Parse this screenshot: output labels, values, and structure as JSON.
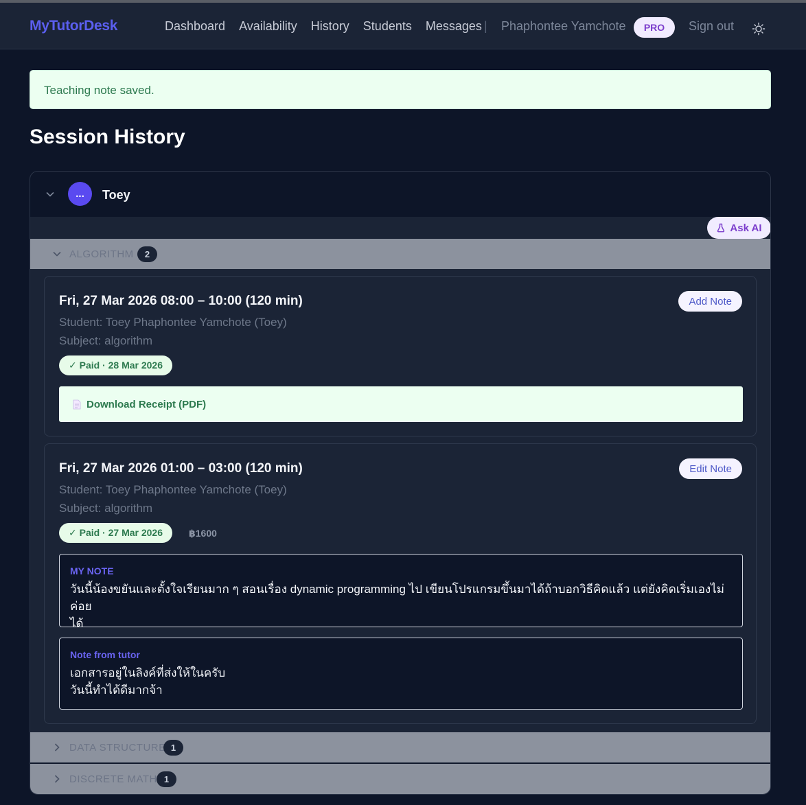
{
  "nav": {
    "brand": "MyTutorDesk",
    "links": [
      "Dashboard",
      "Availability",
      "History",
      "Students",
      "Messages"
    ],
    "separator": "|",
    "user": "Phaphontee Yamchote",
    "badge": "PRO",
    "signout": "Sign out",
    "theme_icon": "sun-icon"
  },
  "alert": {
    "message": "Teaching note saved."
  },
  "page": {
    "title": "Session History"
  },
  "student": {
    "avatar": "...",
    "name": "Toey",
    "ask_ai": "Ask AI"
  },
  "groups": [
    {
      "label": "ALGORITHM",
      "count": "2",
      "expanded": true
    },
    {
      "label": "DATA STRUCTURE",
      "count": "1",
      "expanded": false
    },
    {
      "label": "DISCRETE MATH",
      "count": "1",
      "expanded": false
    }
  ],
  "sessions": [
    {
      "date": "Fri, 27 Mar 2026 08:00 – 10:00 (120 min)",
      "student": "Student: Toey Phaphontee Yamchote (Toey)",
      "subject": "Subject: algorithm",
      "paid": "✓ Paid · 28 Mar 2026",
      "note_button": "Add Note",
      "receipt": "Download Receipt (PDF)"
    },
    {
      "date": "Fri, 27 Mar 2026 01:00 – 03:00 (120 min)",
      "student": "Student: Toey Phaphontee Yamchote (Toey)",
      "subject": "Subject: algorithm",
      "paid": "✓ Paid · 27 Mar 2026",
      "price": "฿1600",
      "note_button": "Edit Note",
      "my_note_title": "MY NOTE",
      "my_note": "วันนี้น้องขยันและตั้งใจเรียนมาก ๆ สอนเรื่อง dynamic programming ไป เขียนโปรแกรมขึ้นมาได้ถ้าบอกวิธีคิดแล้ว แต่ยังคิดเริ่มเองไม่ค่อย\nได้",
      "tutor_note_title": "Note from tutor",
      "tutor_note": "เอกสารอยู่ในลิงค์ที่ส่งให้ในครับ\nวันนี้ทำได้ดีมากจ้า"
    }
  ],
  "colors": {
    "background": "#0d1528",
    "surface": "#1b2436",
    "brand": "#5b5ff0",
    "success": "#2d7a4f",
    "accent_purple": "#7b3dcc"
  }
}
